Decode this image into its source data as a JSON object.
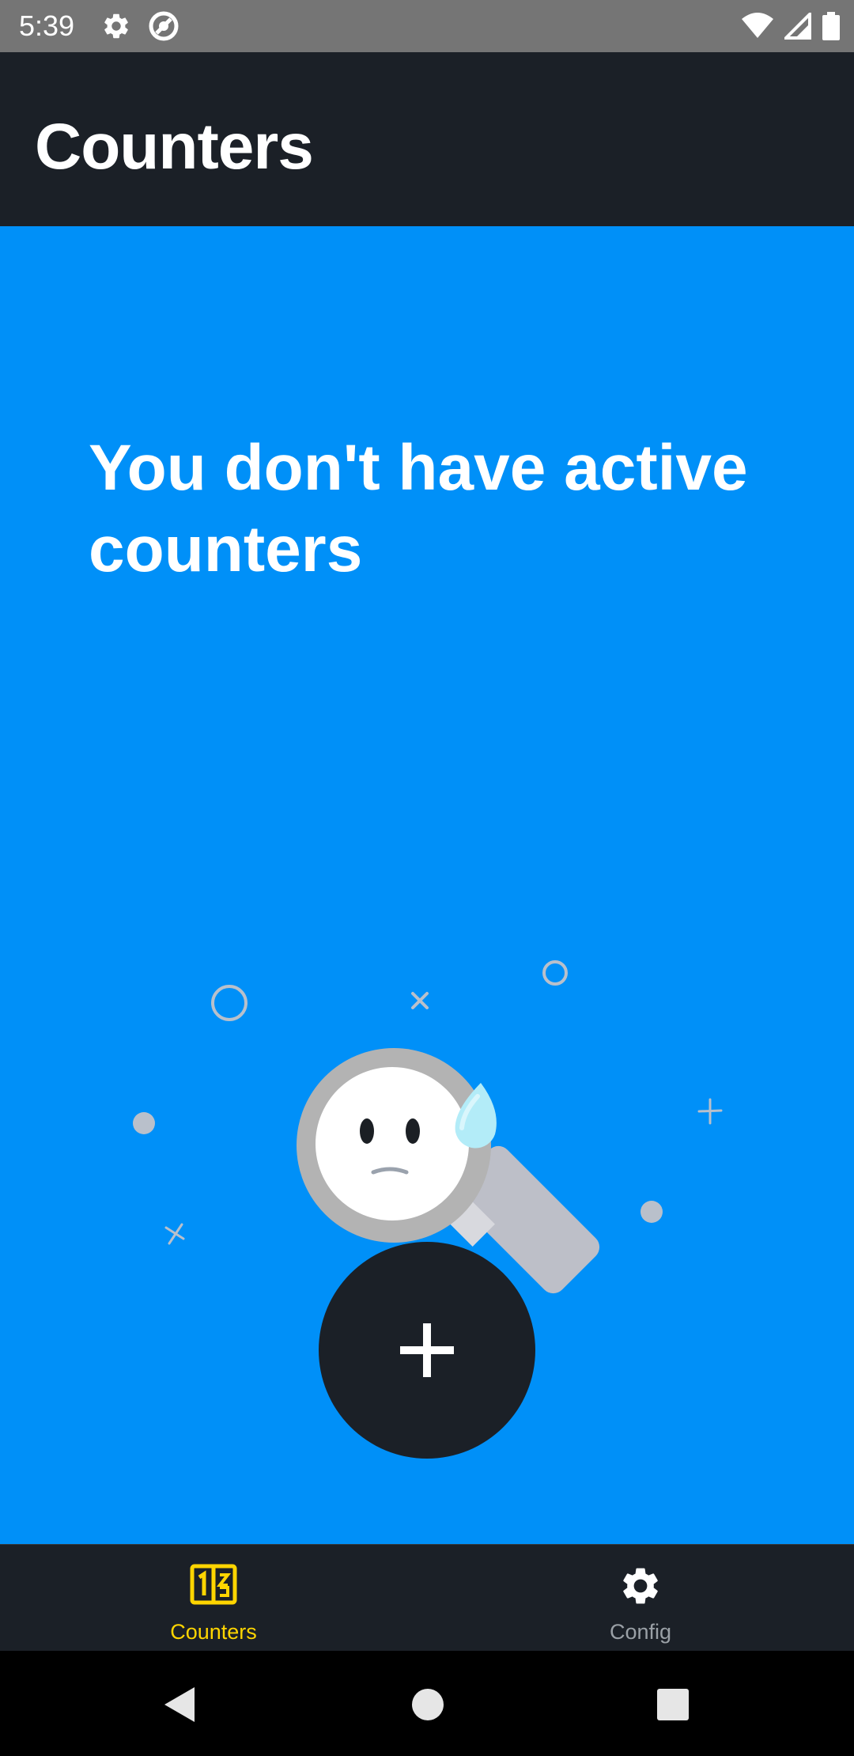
{
  "status_bar": {
    "time": "5:39",
    "left_icons": [
      "gear-icon",
      "do-not-disturb-icon"
    ],
    "right_icons": [
      "wifi-icon",
      "signal-icon",
      "battery-icon"
    ],
    "background": "#757575"
  },
  "app_bar": {
    "title": "Counters",
    "background": "#1b2027"
  },
  "main": {
    "background": "#0090f8",
    "empty_message": "You don't have active counters",
    "illustration": "sad-magnifying-glass-icon"
  },
  "fab": {
    "icon": "plus-icon",
    "background": "#1b2027"
  },
  "bottom_nav": {
    "items": [
      {
        "label": "Counters",
        "icon": "counter-icon",
        "active": true,
        "color": "#ffd500"
      },
      {
        "label": "Config",
        "icon": "gear-icon",
        "active": false,
        "color": "#9aa0a6"
      }
    ]
  },
  "system_nav": {
    "buttons": [
      "back-icon",
      "home-icon",
      "recents-icon"
    ]
  }
}
